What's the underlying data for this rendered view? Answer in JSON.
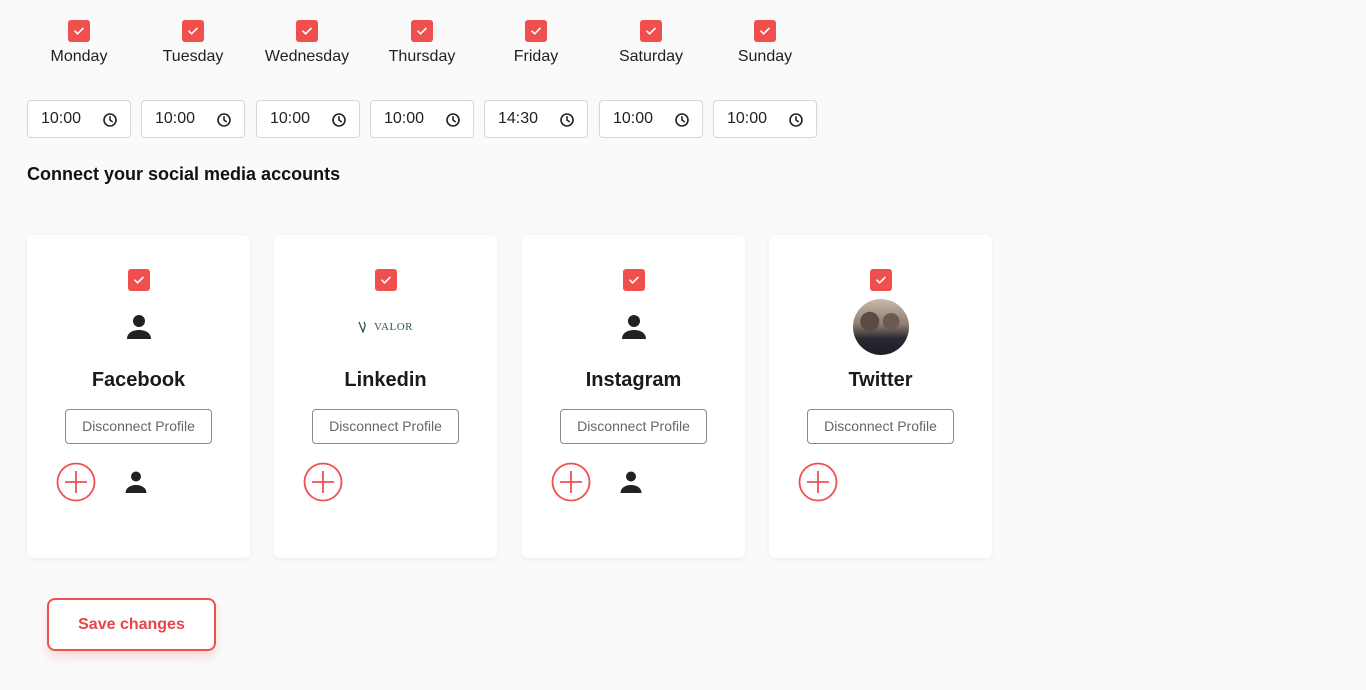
{
  "days": [
    {
      "label": "Monday",
      "checked": true,
      "time": "10:00"
    },
    {
      "label": "Tuesday",
      "checked": true,
      "time": "10:00"
    },
    {
      "label": "Wednesday",
      "checked": true,
      "time": "10:00"
    },
    {
      "label": "Thursday",
      "checked": true,
      "time": "10:00"
    },
    {
      "label": "Friday",
      "checked": true,
      "time": "14:30"
    },
    {
      "label": "Saturday",
      "checked": true,
      "time": "10:00"
    },
    {
      "label": "Sunday",
      "checked": true,
      "time": "10:00"
    }
  ],
  "social": {
    "title": "Connect your social media accounts",
    "accounts": [
      {
        "name": "Facebook",
        "checked": true,
        "avatar": "person-icon",
        "disconnect_label": "Disconnect Profile",
        "has_profile": true
      },
      {
        "name": "Linkedin",
        "checked": true,
        "avatar": "valor-logo",
        "logo_text": "VALOR",
        "disconnect_label": "Disconnect Profile",
        "has_profile": false
      },
      {
        "name": "Instagram",
        "checked": true,
        "avatar": "person-icon",
        "disconnect_label": "Disconnect Profile",
        "has_profile": true
      },
      {
        "name": "Twitter",
        "checked": true,
        "avatar": "profile-photo",
        "disconnect_label": "Disconnect Profile",
        "has_profile": false
      }
    ]
  },
  "save_label": "Save changes",
  "colors": {
    "accent": "#f0504d",
    "text": "#1a1a1a"
  }
}
